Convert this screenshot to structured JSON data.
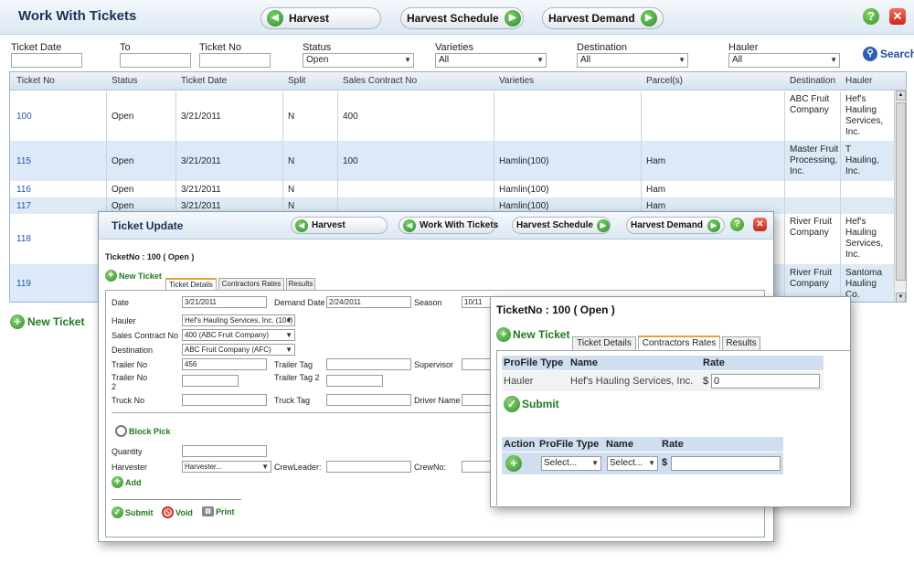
{
  "main": {
    "title": "Work With Tickets",
    "nav": {
      "harvest": "Harvest",
      "harvest_schedule": "Harvest Schedule",
      "harvest_demand": "Harvest Demand"
    },
    "filters": {
      "ticket_date": "Ticket Date",
      "to": "To",
      "ticket_no": "Ticket No",
      "status": "Status",
      "status_value": "Open",
      "varieties": "Varieties",
      "varieties_value": "All",
      "destination": "Destination",
      "destination_value": "All",
      "hauler": "Hauler",
      "hauler_value": "All",
      "search": "Search"
    },
    "columns": [
      "Ticket No",
      "Status",
      "Ticket Date",
      "Split",
      "Sales Contract No",
      "Varieties",
      "Parcel(s)",
      "Destination",
      "Hauler"
    ],
    "rows": [
      {
        "no": "100",
        "status": "Open",
        "date": "3/21/2011",
        "split": "N",
        "contract": "400",
        "varieties": "",
        "parcels": "",
        "destination": "ABC Fruit\nCompany",
        "hauler": "Hef's\nHauling\nServices,\nInc."
      },
      {
        "no": "115",
        "status": "Open",
        "date": "3/21/2011",
        "split": "N",
        "contract": "100",
        "varieties": "Hamlin(100)",
        "parcels": "Ham",
        "destination": "Master Fruit\nProcessing,\nInc.",
        "hauler": "T\nHauling,\nInc."
      },
      {
        "no": "116",
        "status": "Open",
        "date": "3/21/2011",
        "split": "N",
        "contract": "",
        "varieties": "Hamlin(100)",
        "parcels": "Ham",
        "destination": "",
        "hauler": ""
      },
      {
        "no": "117",
        "status": "Open",
        "date": "3/21/2011",
        "split": "N",
        "contract": "",
        "varieties": "Hamlin(100)",
        "parcels": "Ham",
        "destination": "",
        "hauler": ""
      },
      {
        "no": "118",
        "status": "",
        "date": "",
        "split": "",
        "contract": "",
        "varieties": "",
        "parcels": "",
        "destination": "River Fruit\nCompany",
        "hauler": "Hef's\nHauling\nServices,\nInc."
      },
      {
        "no": "119",
        "status": "",
        "date": "",
        "split": "",
        "contract": "",
        "varieties": "",
        "parcels": "",
        "destination": "River Fruit\nCompany",
        "hauler": "Santoma\nHauling\nCo."
      }
    ],
    "new_ticket": "New Ticket"
  },
  "ticket_update": {
    "title": "Ticket Update",
    "nav": {
      "harvest": "Harvest",
      "work_with_tickets": "Work With Tickets",
      "harvest_schedule": "Harvest Schedule",
      "harvest_demand": "Harvest Demand"
    },
    "heading": "TicketNo : 100 ( Open )",
    "new_ticket": "New Ticket",
    "tabs": [
      "Ticket Details",
      "Contractors Rates",
      "Results"
    ],
    "fields": {
      "date_label": "Date",
      "date": "3/21/2011",
      "demand_date_label": "Demand Date",
      "demand_date": "2/24/2011",
      "season_label": "Season",
      "season": "10/11",
      "hauler_label": "Hauler",
      "hauler": "Hef's Hauling Services, Inc. (104)",
      "sales_contract_label": "Sales Contract No",
      "sales_contract": "400 (ABC Fruit Company)",
      "destination_label": "Destination",
      "destination": "ABC Fruit Company (AFC)",
      "trailer_no_label": "Trailer No",
      "trailer_no": "456",
      "trailer_tag_label": "Trailer Tag",
      "supervisor_label": "Supervisor",
      "trailer_no2_label": "Trailer No 2",
      "trailer_tag2_label": "Trailer Tag 2",
      "truck_no_label": "Truck No",
      "truck_tag_label": "Truck Tag",
      "driver_name_label": "Driver Name",
      "block_pick": "Block Pick",
      "quantity_label": "Quantity",
      "harvester_label": "Harvester",
      "harvester": "Harvester...",
      "crewleader_label": "CrewLeader:",
      "crewno_label": "CrewNo:",
      "add": "Add"
    },
    "actions": {
      "submit": "Submit",
      "void": "Void",
      "print": "Print"
    }
  },
  "contractors_rates": {
    "heading": "TicketNo : 100 ( Open )",
    "new_ticket": "New Ticket",
    "tabs": [
      "Ticket Details",
      "Contractors Rates",
      "Results"
    ],
    "table1": {
      "headers": [
        "ProFile Type",
        "Name",
        "Rate"
      ],
      "row": {
        "type": "Hauler",
        "name": "Hef's Hauling Services, Inc.",
        "currency": "$",
        "rate": "0"
      }
    },
    "submit": "Submit",
    "table2": {
      "headers": [
        "Action",
        "ProFile Type",
        "Name",
        "Rate"
      ],
      "type_select": "Select...",
      "name_select": "Select...",
      "currency": "$"
    }
  }
}
